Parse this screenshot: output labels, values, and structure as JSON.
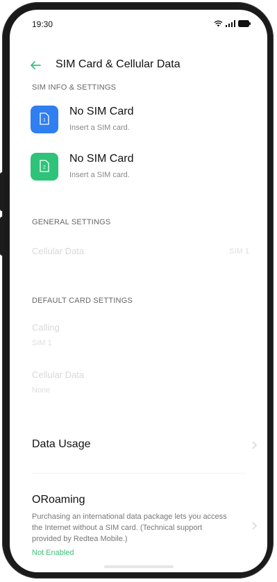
{
  "status_bar": {
    "time": "19:30"
  },
  "header": {
    "title": "SIM Card & Cellular Data"
  },
  "sections": {
    "sim_info": "SIM INFO & SETTINGS",
    "general": "GENERAL SETTINGS",
    "default_card": "DEFAULT CARD SETTINGS"
  },
  "sims": [
    {
      "name": "No SIM Card",
      "subtitle": "Insert a SIM card.",
      "slot": "1",
      "color": "#2f7ff0"
    },
    {
      "name": "No SIM Card",
      "subtitle": "Insert a SIM card.",
      "slot": "2",
      "color": "#2fc37a"
    }
  ],
  "disabled_items": {
    "cellular_data": "Cellular Data",
    "cellular_data_value": "SIM 1",
    "calling": "Calling",
    "calling_value": "SIM 1",
    "cellular_data_2": "Cellular Data",
    "cellular_data_2_value": "None"
  },
  "data_usage": {
    "label": "Data Usage"
  },
  "oroaming": {
    "title": "ORoaming",
    "description": "Purchasing an international data package lets you access the Internet without a SIM card. (Technical support provided by Redtea Mobile.)",
    "status": "Not Enabled"
  },
  "colors": {
    "accent_green": "#3bbf7a",
    "sim1": "#2f7ff0",
    "sim2": "#2fc37a"
  }
}
